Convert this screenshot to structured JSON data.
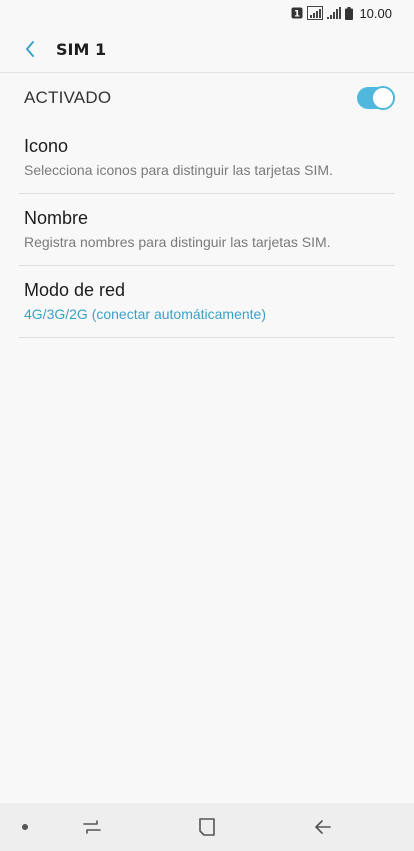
{
  "status_bar": {
    "sim_badge": "1",
    "time": "10.00"
  },
  "app_bar": {
    "title": "SIM 1"
  },
  "master_switch": {
    "label": "ACTIVADO",
    "on": true
  },
  "items": [
    {
      "title": "Icono",
      "subtitle": "Selecciona iconos para distinguir las tarjetas SIM."
    },
    {
      "title": "Nombre",
      "subtitle": "Registra nombres para distinguir las tarjetas SIM."
    },
    {
      "title": "Modo de red",
      "subtitle": "4G/3G/2G (conectar automáticamente)"
    }
  ],
  "colors": {
    "accent": "#4fb8dc",
    "accent_text": "#3ba2c7",
    "background": "#f8f8f8",
    "nav_background": "#eeeeee"
  }
}
